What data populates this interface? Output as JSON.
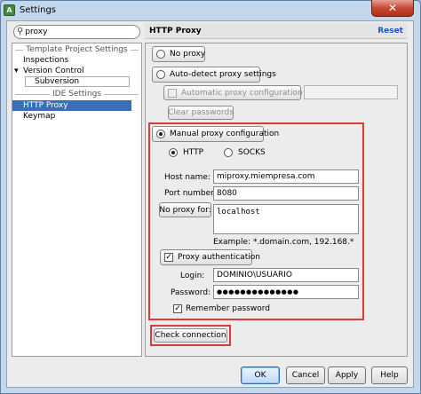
{
  "window": {
    "title": "Settings",
    "icon": "app-logo-icon",
    "close_glyph": "✕"
  },
  "search": {
    "value": "proxy",
    "icon": "search-icon"
  },
  "tree": {
    "items": [
      {
        "label": "Template Project Settings",
        "kind": "separator"
      },
      {
        "label": "Inspections",
        "kind": "item"
      },
      {
        "label": "Version Control",
        "kind": "expanded",
        "toggle": "▾"
      },
      {
        "label": "Subversion",
        "kind": "child"
      },
      {
        "label": "IDE Settings",
        "kind": "separator"
      },
      {
        "label": "HTTP Proxy",
        "kind": "selected"
      },
      {
        "label": "Keymap",
        "kind": "item"
      }
    ]
  },
  "panel": {
    "title": "HTTP Proxy",
    "reset": "Reset",
    "no_proxy": "No proxy",
    "auto_detect": "Auto-detect proxy settings",
    "auto_config_url": "Automatic proxy configuration URL:",
    "auto_config_url_value": "",
    "clear_passwords": "Clear passwords",
    "manual": "Manual proxy configuration",
    "http": "HTTP",
    "socks": "SOCKS",
    "host_label": "Host name:",
    "host_value": "miproxy.miempresa.com",
    "port_label": "Port number:",
    "port_value": "8080",
    "no_proxy_for": "No proxy for:",
    "no_proxy_for_value": "localhost",
    "example": "Example: *.domain.com, 192.168.*",
    "proxy_auth": "Proxy authentication",
    "login_label": "Login:",
    "login_value": "DOMINIO\\USUARIO",
    "password_label": "Password:",
    "password_value": "●●●●●●●●●●●●●●",
    "remember": "Remember password",
    "check_connection": "Check connection"
  },
  "buttons": {
    "ok": "OK",
    "cancel": "Cancel",
    "apply": "Apply",
    "help": "Help"
  },
  "colors": {
    "selection": "#3a6fb5",
    "highlight_box": "#d93a3a",
    "link": "#2255bb"
  }
}
